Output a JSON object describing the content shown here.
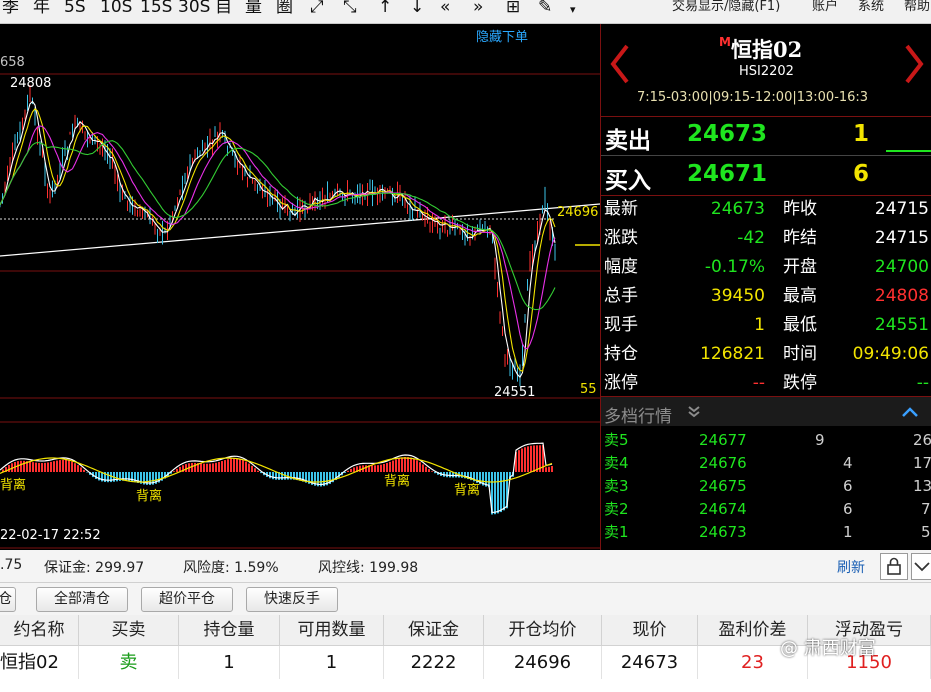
{
  "toolbar": {
    "periods": [
      "季",
      "年",
      "5S",
      "10S",
      "15S",
      "30S"
    ],
    "icons": [
      "自",
      "量",
      "圈"
    ],
    "menu": {
      "trade_display": "交易显示/隐藏(F1)",
      "account": "账户",
      "system": "系统",
      "help": "帮助"
    }
  },
  "chart": {
    "hide_order_label": "隐藏下单",
    "price_top": "658",
    "high_label": "24808",
    "low_label": "24551",
    "open_price_label": "24696",
    "right_fragment": "55",
    "divergence_label": "背离",
    "timestamp": "22-02-17 22:52",
    "colors": {
      "candle_up": "#ff3030",
      "candle_down": "#3cc3e8",
      "ma_white": "#ffffff",
      "ma_yellow": "#f2e400",
      "ma_magenta": "#e830e8",
      "ma_green": "#33cc33"
    }
  },
  "chart_data": {
    "type": "line",
    "series": [],
    "annotations": [
      "24808",
      "24551",
      "24696",
      "背离"
    ],
    "indicator": "MACD"
  },
  "quote": {
    "name": "恒指02",
    "m_mark": "M",
    "code": "HSI2202",
    "hours": "7:15-03:00|09:15-12:00|13:00-16:3",
    "sell": {
      "label": "卖出",
      "price": "24673",
      "volume": "1"
    },
    "buy": {
      "label": "买入",
      "price": "24671",
      "volume": "6"
    },
    "stats": [
      {
        "k1": "最新",
        "v1": "24673",
        "c1": "#1fe51f",
        "k2": "昨收",
        "v2": "24715",
        "c2": "#ffffff"
      },
      {
        "k1": "涨跌",
        "v1": "-42",
        "c1": "#1fe51f",
        "k2": "昨结",
        "v2": "24715",
        "c2": "#ffffff"
      },
      {
        "k1": "幅度",
        "v1": "-0.17%",
        "c1": "#1fe51f",
        "k2": "开盘",
        "v2": "24700",
        "c2": "#1fe51f"
      },
      {
        "k1": "总手",
        "v1": "39450",
        "c1": "#f2e400",
        "k2": "最高",
        "v2": "24808",
        "c2": "#ff3030"
      },
      {
        "k1": "现手",
        "v1": "1",
        "c1": "#f2e400",
        "k2": "最低",
        "v2": "24551",
        "c2": "#1fe51f"
      },
      {
        "k1": "持仓",
        "v1": "126821",
        "c1": "#f2e400",
        "k2": "时间",
        "v2": "09:49:06",
        "c2": "#f2e400"
      },
      {
        "k1": "涨停",
        "v1": "--",
        "c1": "#ff3030",
        "k2": "跌停",
        "v2": "--",
        "c2": "#1fe51f"
      }
    ],
    "depth_title": "多档行情",
    "depth": [
      {
        "level": "卖5",
        "price": "24677",
        "vol": "9",
        "extra": "26"
      },
      {
        "level": "卖4",
        "price": "24676",
        "vol": "4",
        "extra": "17"
      },
      {
        "level": "卖3",
        "price": "24675",
        "vol": "6",
        "extra": "13"
      },
      {
        "level": "卖2",
        "price": "24674",
        "vol": "6",
        "extra": "7"
      },
      {
        "level": "卖1",
        "price": "24673",
        "vol": "1",
        "extra": "5"
      }
    ]
  },
  "account": {
    "equity_fragment": ".75",
    "margin": "保证金: 299.97",
    "risk": "风险度: 1.59%",
    "risk_line": "风控线: 199.98",
    "refresh": "刷新"
  },
  "buttons": {
    "fragment": "仓",
    "close_all": "全部清仓",
    "over_price_close": "超价平仓",
    "quick_reverse": "快速反手"
  },
  "positions": {
    "headers": [
      "约名称",
      "买卖",
      "持仓量",
      "可用数量",
      "保证金",
      "开仓均价",
      "现价",
      "盈利价差",
      "浮动盈亏"
    ],
    "rows": [
      {
        "name": "恒指02",
        "side": "卖",
        "qty": "1",
        "avail": "1",
        "margin": "2222",
        "avg": "24696",
        "price": "24673",
        "diff": "23",
        "pnl": "1150"
      }
    ],
    "colors": {
      "side": "#1a9c1a",
      "profit": "#e02020"
    }
  },
  "watermark": "@ 肃西财富"
}
